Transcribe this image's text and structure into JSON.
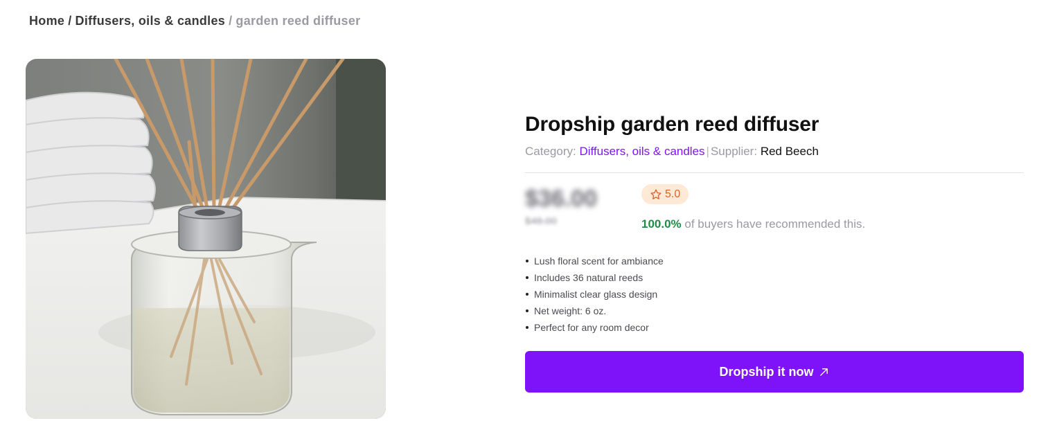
{
  "breadcrumb": {
    "home": "Home",
    "separator": "/",
    "category": "Diffusers, oils & candles",
    "current": "garden reed diffuser"
  },
  "product": {
    "title": "Dropship garden reed diffuser",
    "category_label": "Category:",
    "category": "Diffusers, oils & candles",
    "pipe": "|",
    "supplier_label": "Supplier:",
    "supplier": "Red Beech",
    "price": "$36.00",
    "old_price": "$48.00",
    "rating": "5.0",
    "recommend_pct": "100.0%",
    "recommend_text": "of buyers have recommended this.",
    "features": [
      "Lush floral scent for ambiance",
      "Includes 36 natural reeds",
      "Minimalist clear glass design",
      "Net weight: 6 oz.",
      "Perfect for any room decor"
    ],
    "cta_label": "Dropship it now"
  },
  "icons": {
    "rating": "star-outline-icon",
    "cta": "arrow-up-right-icon"
  },
  "colors": {
    "accent": "#7e12f8",
    "rating_bg": "#fde9d6",
    "rating_fg": "#d9642a",
    "recommend_green": "#1f8b44",
    "muted": "#9a9aa2"
  }
}
